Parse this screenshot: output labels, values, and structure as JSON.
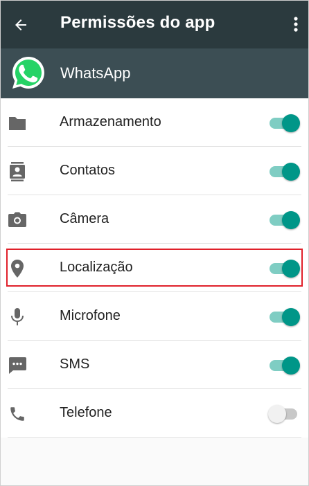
{
  "toolbar": {
    "title": "Permissões do app",
    "back_icon": "arrow-left-icon",
    "more_icon": "more-vert-icon"
  },
  "app": {
    "name": "WhatsApp",
    "icon": "whatsapp-logo-icon",
    "brand_color": "#25d366"
  },
  "colors": {
    "toolbar_bg": "#2b3a3e",
    "app_header_bg": "#3c4e54",
    "toggle_on": "#009688",
    "highlight": "#e0202a"
  },
  "permissions": [
    {
      "label": "Armazenamento",
      "icon": "folder-icon",
      "enabled": true
    },
    {
      "label": "Contatos",
      "icon": "contacts-icon",
      "enabled": true
    },
    {
      "label": "Câmera",
      "icon": "camera-icon",
      "enabled": true
    },
    {
      "label": "Localização",
      "icon": "location-pin-icon",
      "enabled": true,
      "highlighted": true
    },
    {
      "label": "Microfone",
      "icon": "microphone-icon",
      "enabled": true
    },
    {
      "label": "SMS",
      "icon": "sms-icon",
      "enabled": true
    },
    {
      "label": "Telefone",
      "icon": "phone-icon",
      "enabled": false
    }
  ]
}
